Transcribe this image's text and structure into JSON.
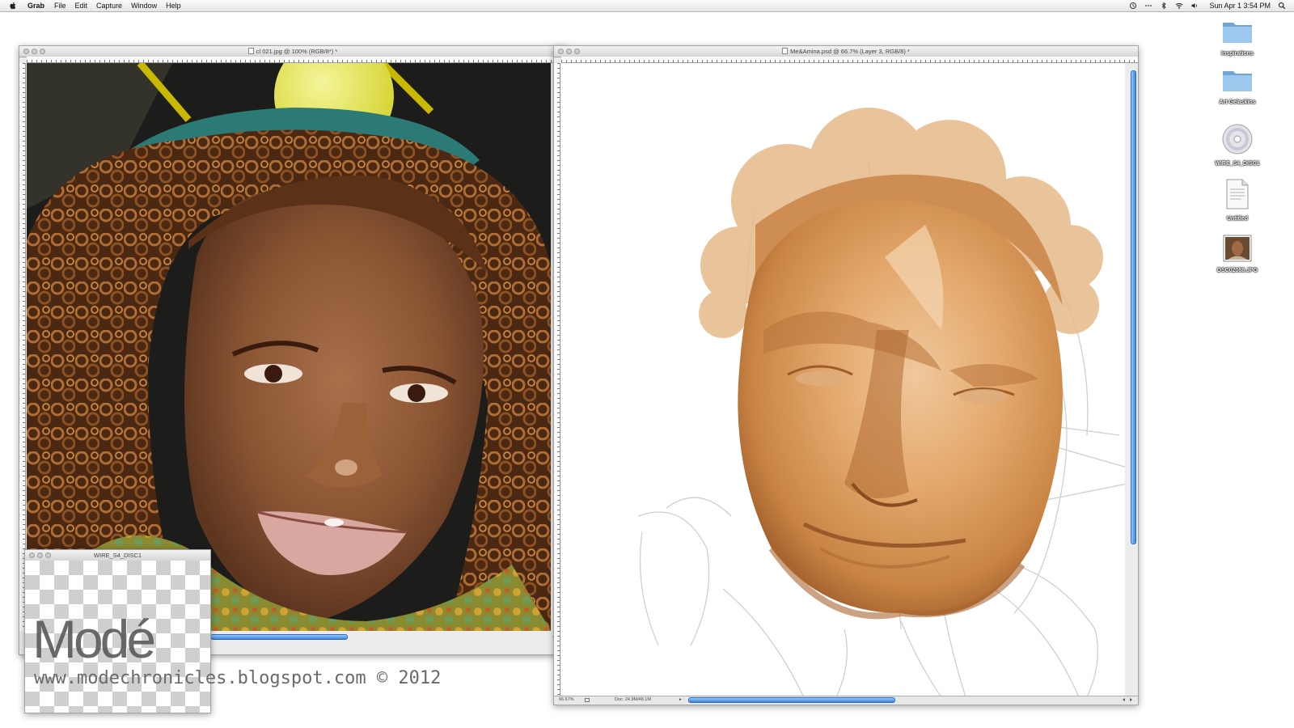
{
  "menubar": {
    "app": "Grab",
    "items": [
      "File",
      "Edit",
      "Capture",
      "Window",
      "Help"
    ],
    "clock": "Sun Apr 1  3:54 PM"
  },
  "photo_window": {
    "title": "cl 021.jpg @ 100% (RGB/8*) *"
  },
  "paint_window": {
    "title": "Me&Amina.psd @ 66.7% (Layer 3, RGB/8) *",
    "zoom": "66.67%",
    "doc_size": "Doc: 24.9M/48.1M"
  },
  "small_window": {
    "title": "WIRE_S4_DISC1"
  },
  "watermark": {
    "logo": "Modé",
    "url": "www.modechronicles.blogspot.com © 2012"
  },
  "desktop_icons": [
    {
      "label": "Inspirations",
      "icon": "folder-icon"
    },
    {
      "label": "Art Gelaskins",
      "icon": "folder-icon"
    },
    {
      "label": "WIRE_S4_DISC1",
      "icon": "dvd-icon"
    },
    {
      "label": "Untitled",
      "icon": "rtf-document-icon"
    },
    {
      "label": "DSC02088.JPG",
      "icon": "image-file-icon"
    }
  ],
  "colors": {
    "skin_base": "#d89a5c",
    "skin_light": "#e8b682",
    "skin_shadow": "#a8652f",
    "photo_skin": "#8a5433",
    "hair": "#6b3b1c",
    "scroll_accent": "#3b86e0"
  }
}
